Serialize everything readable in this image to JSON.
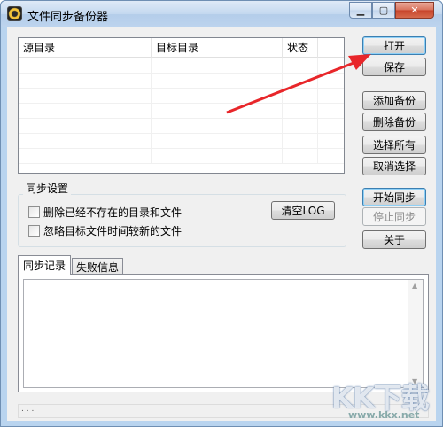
{
  "window": {
    "title": "文件同步备份器",
    "min_glyph": "▁",
    "max_glyph": "▢",
    "close_glyph": "✕"
  },
  "list": {
    "columns": [
      "源目录",
      "目标目录",
      "状态"
    ]
  },
  "buttons": {
    "open": "打开",
    "save": "保存",
    "add_backup": "添加备份",
    "delete_backup": "删除备份",
    "select_all": "选择所有",
    "cancel_selection": "取消选择",
    "start_sync": "开始同步",
    "stop_sync": "停止同步",
    "about": "关于",
    "clear_log": "清空LOG"
  },
  "sync_settings": {
    "title": "同步设置",
    "option_delete": "删除已经不存在的目录和文件",
    "option_ignore": "忽略目标文件时间较新的文件",
    "option_delete_checked": false,
    "option_ignore_checked": false
  },
  "tabs": [
    {
      "label": "同步记录",
      "active": true
    },
    {
      "label": "失败信息",
      "active": false
    }
  ],
  "status": {
    "text": ". . ."
  },
  "watermark": {
    "logo": "KK下载",
    "url": "www.kkx.net"
  },
  "colors": {
    "arrow": "#e8262a"
  }
}
